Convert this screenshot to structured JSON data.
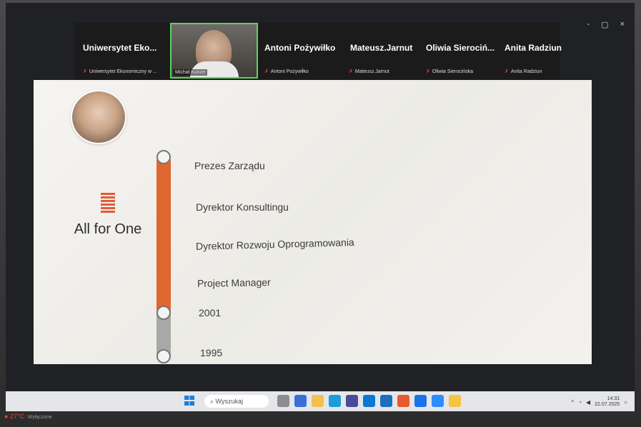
{
  "window": {
    "controls": [
      "-",
      "▢",
      "×"
    ]
  },
  "meeting": {
    "participants": [
      {
        "name": "Uniwersytet Eko...",
        "caption": "Uniwersytet Ekonomiczny w ..."
      },
      {
        "name": "",
        "caption": "Michał Kunze"
      },
      {
        "name": "Antoni Pożywiłko",
        "caption": "Antoni Pożywiłko"
      },
      {
        "name": "Mateusz.Jarnut",
        "caption": "Mateusz.Jarnut"
      },
      {
        "name": "Oliwia Sierociń...",
        "caption": "Oliwia Sierocińska"
      },
      {
        "name": "Anita Radziun",
        "caption": "Anita Radziun"
      }
    ]
  },
  "slide": {
    "logo_text": "All for One",
    "roles": [
      "Prezes Zarządu",
      "Dyrektor Konsultingu",
      "Dyrektor Rozwoju Oprogramowania",
      "Project Manager"
    ],
    "years": [
      "2001",
      "1995"
    ]
  },
  "taskbar": {
    "search_placeholder": "Wyszukaj",
    "time": "14:31",
    "date": "22.07.2025"
  },
  "weather": {
    "temp": "27°C",
    "status": "Wyłączone"
  },
  "colors": {
    "accent": "#e0662f",
    "timeline_grey": "#a8a8a8"
  }
}
